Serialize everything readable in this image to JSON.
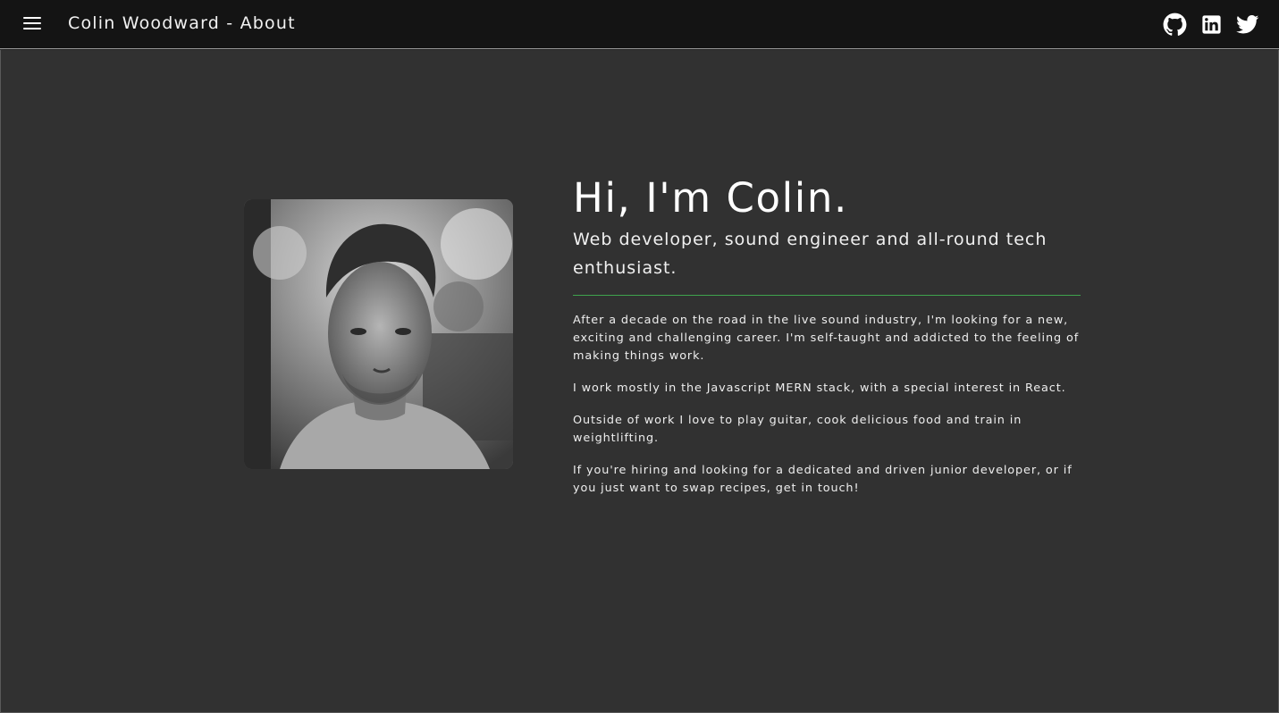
{
  "appbar": {
    "title": "Colin Woodward - About",
    "menu_icon": "menu-icon",
    "social": [
      {
        "name": "github",
        "icon": "github-icon"
      },
      {
        "name": "linkedin",
        "icon": "linkedin-icon"
      },
      {
        "name": "twitter",
        "icon": "twitter-icon"
      }
    ]
  },
  "about": {
    "headline": "Hi, I'm Colin.",
    "subhead": "Web developer, sound engineer and all-round tech enthusiast.",
    "paragraphs": [
      "After a decade on the road in the live sound industry, I'm looking for a new, exciting and challenging career. I'm self-taught and addicted to the feeling of making things work.",
      "I work mostly in the Javascript MERN stack, with a special interest in React.",
      "Outside of work I love to play guitar, cook delicious food and train in weightlifting.",
      "If you're hiring and looking for a dedicated and driven junior developer, or if you just want to swap recipes, get in touch!"
    ]
  },
  "colors": {
    "appbar_bg": "#141414",
    "page_bg": "#313131",
    "accent_divider": "#3fa34d",
    "text": "#ffffff"
  }
}
